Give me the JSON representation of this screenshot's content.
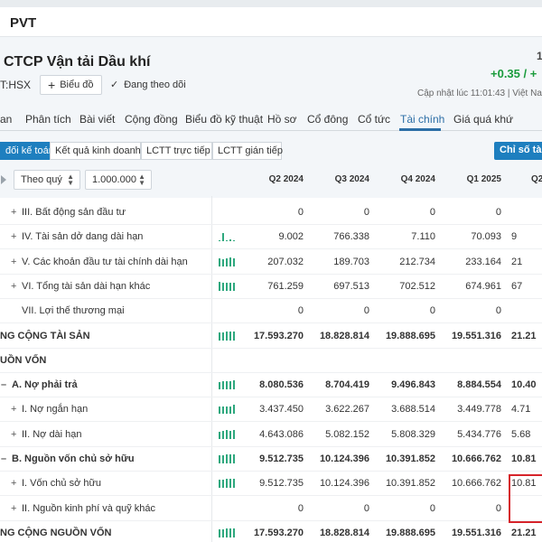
{
  "window": {
    "title": "PVT"
  },
  "company": {
    "name": "CTCP Vận tải Dầu khí",
    "ticker": "T:HSX",
    "chart_button": "Biểu đồ",
    "follow_label": "Đang theo dõi",
    "price_change": "+0.35 / +",
    "top_right_fragment": "1",
    "updated": "Cập nhật lúc  11:01:43 | Việt Nam"
  },
  "nav": {
    "items": [
      "an",
      "Phân tích",
      "Bài viết",
      "Cộng đồng",
      "Biểu đồ kỹ thuật",
      "Hồ sơ",
      "Cổ đông",
      "Cổ tức",
      "Tài chính",
      "Giá quá khứ"
    ],
    "active": "Tài chính"
  },
  "subtabs": {
    "items": [
      "đối kế toán",
      "Kết quả kinh doanh",
      "LCTT trực tiếp",
      "LCTT gián tiếp"
    ],
    "active_index": 0,
    "ratio_button": "Chỉ số tài c"
  },
  "filters": {
    "period": "Theo quý",
    "unit": "1.000.000"
  },
  "columns": [
    "Q2 2024",
    "Q3 2024",
    "Q4 2024",
    "Q1 2025",
    "Q2"
  ],
  "rows": [
    {
      "pm": "+",
      "label": "III. Bất động sản đầu tư",
      "values": [
        "0",
        "0",
        "0",
        "0",
        ""
      ],
      "spark": [],
      "bold": false,
      "indent": 12
    },
    {
      "pm": "+",
      "label": "IV. Tài sản dở dang dài hạn",
      "values": [
        "9.002",
        "766.338",
        "7.110",
        "70.093",
        "9"
      ],
      "spark": [
        0.1,
        0.9,
        0.1,
        0.2,
        0.1
      ],
      "bold": false,
      "indent": 12
    },
    {
      "pm": "+",
      "label": "V. Các khoản đầu tư tài chính dài hạn",
      "values": [
        "207.032",
        "189.703",
        "212.734",
        "233.164",
        "21"
      ],
      "spark": [
        0.85,
        0.8,
        0.9,
        1.0,
        0.92
      ],
      "bold": false,
      "indent": 12
    },
    {
      "pm": "+",
      "label": "VI. Tổng tài sản dài hạn khác",
      "values": [
        "761.259",
        "697.513",
        "702.512",
        "674.961",
        "67"
      ],
      "spark": [
        1.0,
        0.92,
        0.93,
        0.89,
        0.9
      ],
      "bold": false,
      "indent": 12
    },
    {
      "pm": "",
      "label": "VII. Lợi thế thương mại",
      "values": [
        "0",
        "0",
        "0",
        "0",
        ""
      ],
      "spark": [],
      "bold": false,
      "indent": 24
    },
    {
      "pm": "",
      "label": "NG CỘNG TÀI SẢN",
      "values": [
        "17.593.270",
        "18.828.814",
        "19.888.695",
        "19.551.316",
        "21.21"
      ],
      "spark": [
        0.88,
        0.92,
        0.97,
        0.95,
        1.0
      ],
      "bold": true,
      "indent": 0
    },
    {
      "pm": "",
      "label": "UỒN VỐN",
      "values": [
        "",
        "",
        "",
        "",
        ""
      ],
      "spark": [],
      "bold": true,
      "indent": 0
    },
    {
      "pm": "–",
      "label": "A. Nợ phải trả",
      "values": [
        "8.080.536",
        "8.704.419",
        "9.496.843",
        "8.884.554",
        "10.40"
      ],
      "spark": [
        0.8,
        0.86,
        0.94,
        0.88,
        1.0
      ],
      "bold": true,
      "indent": 0
    },
    {
      "pm": "+",
      "label": "I. Nợ ngắn hạn",
      "values": [
        "3.437.450",
        "3.622.267",
        "3.688.514",
        "3.449.778",
        "4.71"
      ],
      "spark": [
        0.75,
        0.8,
        0.82,
        0.76,
        1.0
      ],
      "bold": false,
      "indent": 12
    },
    {
      "pm": "+",
      "label": "II. Nợ dài hạn",
      "values": [
        "4.643.086",
        "5.082.152",
        "5.808.329",
        "5.434.776",
        "5.68"
      ],
      "spark": [
        0.8,
        0.87,
        1.0,
        0.93,
        0.98
      ],
      "bold": false,
      "indent": 12
    },
    {
      "pm": "–",
      "label": "B. Nguồn vốn chủ sở hữu",
      "values": [
        "9.512.735",
        "10.124.396",
        "10.391.852",
        "10.666.762",
        "10.81"
      ],
      "spark": [
        0.88,
        0.94,
        0.96,
        0.99,
        1.0
      ],
      "bold": true,
      "indent": 0
    },
    {
      "pm": "+",
      "label": "I. Vốn chủ sở hữu",
      "values": [
        "9.512.735",
        "10.124.396",
        "10.391.852",
        "10.666.762",
        "10.81"
      ],
      "spark": [
        0.88,
        0.94,
        0.96,
        0.99,
        1.0
      ],
      "bold": false,
      "indent": 12
    },
    {
      "pm": "+",
      "label": "II. Nguồn kinh phí và quỹ khác",
      "values": [
        "0",
        "0",
        "0",
        "0",
        ""
      ],
      "spark": [],
      "bold": false,
      "indent": 12
    },
    {
      "pm": "",
      "label": "NG CỘNG NGUỒN VỐN",
      "values": [
        "17.593.270",
        "18.828.814",
        "19.888.695",
        "19.551.316",
        "21.21"
      ],
      "spark": [
        0.88,
        0.92,
        0.97,
        0.95,
        1.0
      ],
      "bold": true,
      "indent": 0
    }
  ],
  "colors": {
    "accent": "#1e7fbf",
    "up": "#1a9b3c",
    "spark": "#2ea87e",
    "highlight": "#d6232a"
  }
}
